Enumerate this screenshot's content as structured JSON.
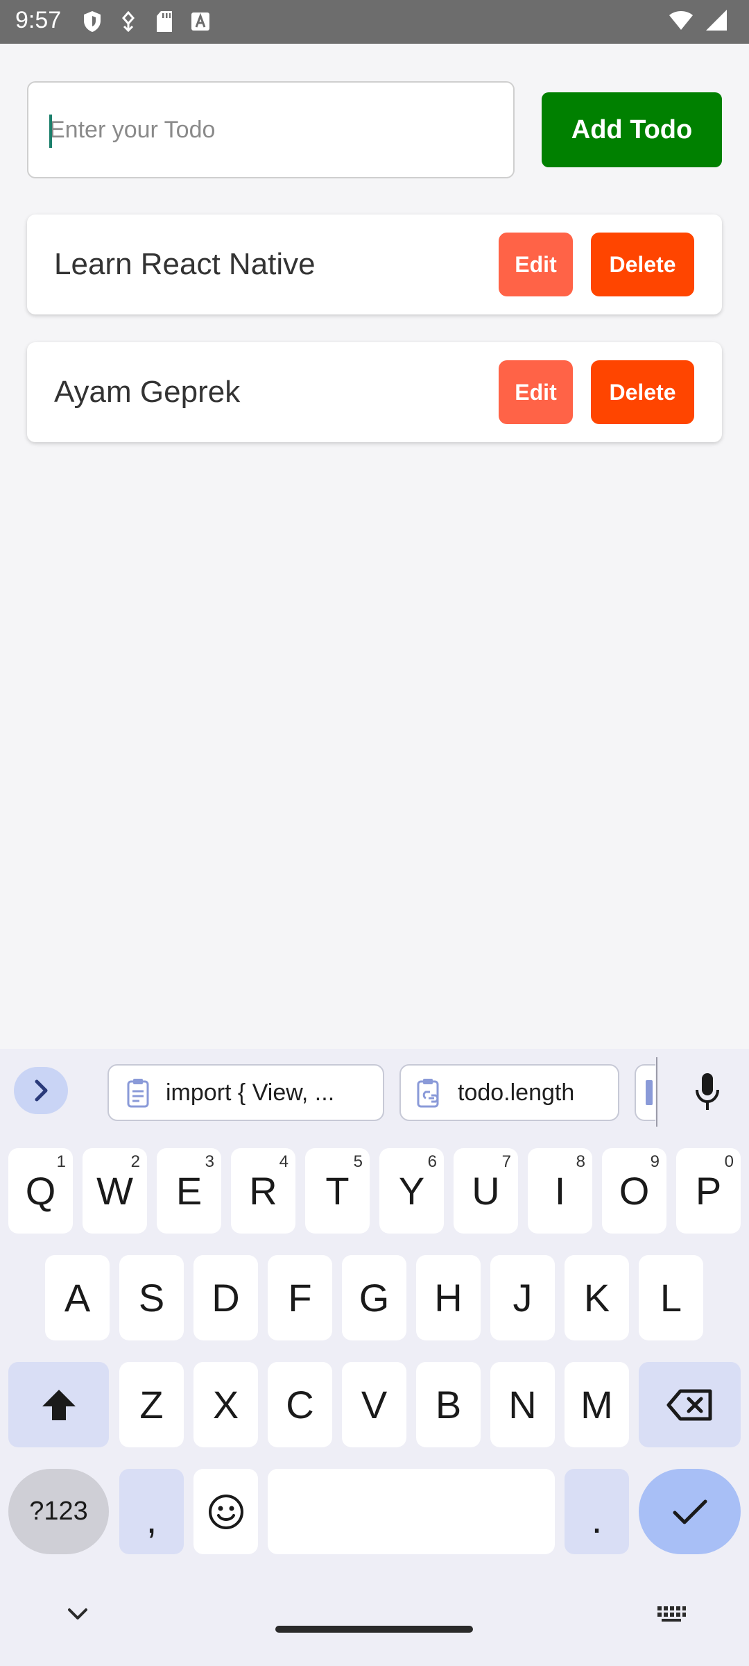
{
  "status_bar": {
    "time": "9:57",
    "left_icons": [
      "shield-icon",
      "usb-debug-icon",
      "sd-card-icon",
      "keyboard-a-icon"
    ],
    "right_icons": [
      "wifi-icon",
      "signal-icon"
    ]
  },
  "app": {
    "input": {
      "placeholder": "Enter your Todo",
      "value": ""
    },
    "add_button": "Add Todo",
    "todos": [
      {
        "text": "Learn React Native",
        "edit_label": "Edit",
        "delete_label": "Delete"
      },
      {
        "text": "Ayam Geprek",
        "edit_label": "Edit",
        "delete_label": "Delete"
      }
    ],
    "colors": {
      "add": "#008000",
      "edit": "#ff6347",
      "delete": "#ff4500"
    }
  },
  "keyboard": {
    "suggestions": [
      "import { View, ...",
      "todo.length"
    ],
    "row1": [
      {
        "key": "Q",
        "hint": "1"
      },
      {
        "key": "W",
        "hint": "2"
      },
      {
        "key": "E",
        "hint": "3"
      },
      {
        "key": "R",
        "hint": "4"
      },
      {
        "key": "T",
        "hint": "5"
      },
      {
        "key": "Y",
        "hint": "6"
      },
      {
        "key": "U",
        "hint": "7"
      },
      {
        "key": "I",
        "hint": "8"
      },
      {
        "key": "O",
        "hint": "9"
      },
      {
        "key": "P",
        "hint": "0"
      }
    ],
    "row2": [
      "A",
      "S",
      "D",
      "F",
      "G",
      "H",
      "J",
      "K",
      "L"
    ],
    "row3": [
      "Z",
      "X",
      "C",
      "V",
      "B",
      "N",
      "M"
    ],
    "symbols_label": "?123",
    "comma": ",",
    "period": "."
  }
}
